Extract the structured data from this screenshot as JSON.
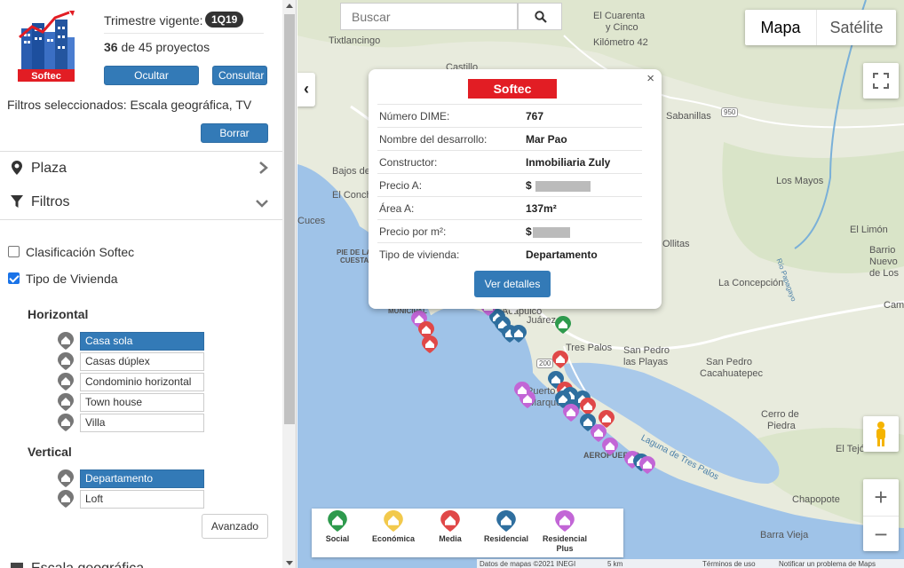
{
  "sidebar": {
    "logo": {
      "text": "Softec",
      "icon": "building-chart-logo"
    },
    "trimester_label": "Trimestre vigente:",
    "trimester_value": "1Q19",
    "projects_shown": "36",
    "projects_text": " de 45 proyectos",
    "hide_projects_label": "Ocultar proyectos",
    "consult_label": "Consultar",
    "selected_filters": "Filtros seleccionados: Escala geográfica, TV",
    "clear_filters_label": "Borrar filtros",
    "sections": [
      {
        "label": "Plaza",
        "icon": "map-marker-icon",
        "chevron": "chevron-right-icon"
      },
      {
        "label": "Filtros",
        "icon": "filter-icon",
        "chevron": "chevron-down-icon"
      }
    ],
    "checkboxes": [
      {
        "label": "Clasificación Softec",
        "checked": false
      },
      {
        "label": "Tipo de Vivienda",
        "checked": true
      }
    ],
    "horizontal": {
      "title": "Horizontal",
      "options": [
        "Casa sola",
        "Casas dúplex",
        "Condominio horizontal",
        "Town house",
        "Villa"
      ],
      "selected": "Casa sola"
    },
    "vertical": {
      "title": "Vertical",
      "options": [
        "Departamento",
        "Loft"
      ],
      "selected": "Departamento"
    },
    "advanced_label": "Avanzado",
    "bottom_section": "Escala geográfica"
  },
  "map": {
    "search_placeholder": "Buscar",
    "map_type": {
      "map": "Mapa",
      "satellite": "Satélite",
      "active": "Mapa"
    },
    "collapse_label": "‹",
    "zoom_in": "+",
    "zoom_out": "−",
    "places": [
      "El Cuarenta",
      "y Cinco",
      "Kilómetro 42",
      "Tixtlancingo",
      "Castillo",
      "Sabanillas",
      "Bajos del Ejido",
      "El Conchero",
      "Los Mayos",
      "Cuces",
      "El Limón",
      "Ollitas",
      "Barrio",
      "Nuevo",
      "de Los",
      "La Concepción",
      "Campo",
      "PIE DE LA",
      "CUESTA",
      "Tres Palos",
      "San Pedro",
      "las Playas",
      "San Pedro",
      "Cacahuatepec",
      "Cerro de",
      "Piedra",
      "El Tejón",
      "Chapopote",
      "Barra Vieja",
      "Laguna de Tres Palos",
      "Juárez",
      "Puerto",
      "Marqués",
      "AEROPUERTO",
      "MUNICIPAL",
      "Acapulco",
      "Río Papagayo",
      "200",
      "950"
    ],
    "popup": {
      "logo": "Softec",
      "close": "×",
      "rows": [
        {
          "label": "Número DIME:",
          "value": "767"
        },
        {
          "label": "Nombre del desarrollo:",
          "value": "Mar Pao"
        },
        {
          "label": "Constructor:",
          "value": "Inmobiliaria Zuly"
        },
        {
          "label": "Precio A:",
          "value": "$"
        },
        {
          "label": "Área A:",
          "value": "137m²"
        },
        {
          "label": "Precio por m²:",
          "value": "$"
        },
        {
          "label": "Tipo de vivienda:",
          "value": "Departamento"
        }
      ],
      "details_label": "Ver detalles"
    },
    "legend": [
      {
        "label": "Social",
        "color": "#2e9a4d"
      },
      {
        "label": "Económica",
        "color": "#f2c94c"
      },
      {
        "label": "Media",
        "color": "#e04848"
      },
      {
        "label": "Residencial",
        "color": "#2f6f9f"
      },
      {
        "label": "Residencial Plus",
        "color": "#c266d6"
      }
    ],
    "attribution": {
      "data": "Datos de mapas ©2021 INEGI",
      "scale": "5 km",
      "terms": "Términos de uso",
      "report": "Notificar un problema de Maps"
    }
  }
}
